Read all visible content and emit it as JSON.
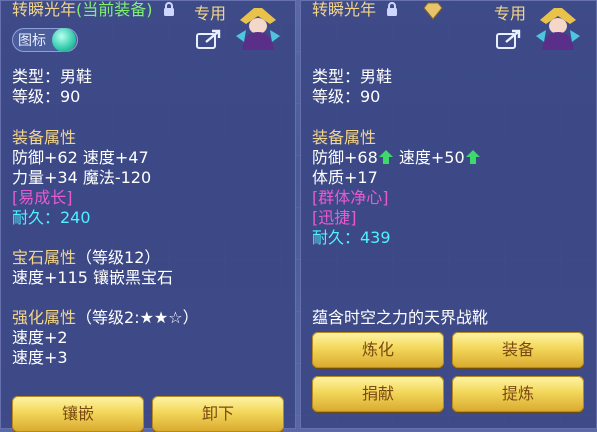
{
  "left": {
    "title_name": "转瞬光年",
    "title_status": "(当前装备)",
    "dedicated_label": "专用",
    "icon_toggle_label": "图标",
    "type_line": "类型：男鞋",
    "level_line": "等级：90",
    "equip_attr_header": "装备属性",
    "stat_line1": "防御+62 速度+47",
    "stat_line2": "力量+34 魔法-120",
    "special_effect": "[易成长]",
    "durability_line": "耐久：240",
    "gem_header": "宝石属性",
    "gem_level": "（等级12）",
    "gem_detail": "速度+115 镶嵌黑宝石",
    "enhance_header": "强化属性",
    "enhance_level": "（等级2:★★☆）",
    "enhance_line1": "速度+2",
    "enhance_line2": "速度+3",
    "buttons": {
      "inlay": "镶嵌",
      "unequip": "卸下"
    }
  },
  "right": {
    "title_name": "转瞬光年",
    "dedicated_label": "专用",
    "type_line": "类型：男鞋",
    "level_line": "等级：90",
    "equip_attr_header": "装备属性",
    "stat_line1_a": "防御+68",
    "stat_line1_b": "速度+50",
    "stat_line2": "体质+17",
    "special_effect1": "[群体净心]",
    "special_effect2": "[迅捷]",
    "durability_line": "耐久：439",
    "description": "蕴含时空之力的天界战靴",
    "buttons": {
      "refine": "炼化",
      "equip": "装备",
      "donate": "捐献",
      "extract": "提炼"
    }
  },
  "colors": {
    "gold": "#f3d58a",
    "green": "#7ef071",
    "pink": "#e85ad0",
    "cyan": "#4ff0ff",
    "button_text": "#7b4a12"
  },
  "icons": [
    "lock-icon",
    "character-portrait-icon",
    "share-icon",
    "toggle-knob-icon",
    "up-arrow-icon",
    "diamond-badge-icon"
  ]
}
